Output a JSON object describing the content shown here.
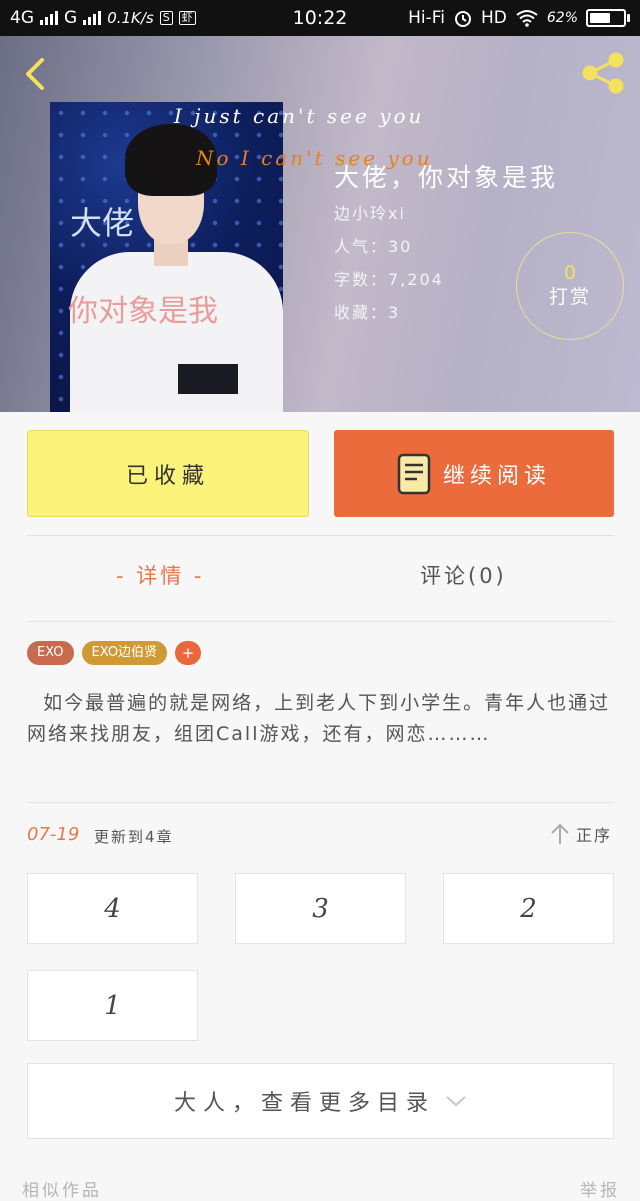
{
  "status_bar": {
    "network_1": "4G",
    "network_2": "G",
    "speed": "0.1K/s",
    "badge_1": "S",
    "badge_2": "虾",
    "time": "10:22",
    "wifi_label": "Hi-Fi",
    "hd_label": "HD",
    "battery": "62%",
    "battery_level": 0.62,
    "icons": [
      "signal-icon",
      "alarm-icon",
      "wifi-icon",
      "battery-icon"
    ]
  },
  "header": {
    "cover_lyric_1": "I just can't see you",
    "cover_lyric_2": "No I can't see you",
    "cover_caption_1": "大佬",
    "cover_caption_2": "你对象是我",
    "title": "大佬，你对象是我",
    "author": "边小玲xi",
    "popularity": "人气：30",
    "word_count": "字数：7,204",
    "favorites": "收藏：3",
    "tip_count": "0",
    "tip_label": "打赏",
    "back_icon": "chevron-left-icon",
    "share_icon": "share-icon",
    "accent_color": "#f4e15c"
  },
  "actions": {
    "collected_label": "已收藏",
    "read_label": "继续阅读",
    "collected_color": "#fbf37a",
    "read_color": "#ec6b3d"
  },
  "tabs": {
    "details": "- 详情 -",
    "comments": "评论(0)"
  },
  "tags": [
    "EXO",
    "EXO边伯贤",
    "+"
  ],
  "intro": "如今最普遍的就是网络，上到老人下到小学生。青年人也通过网络来找朋友，组团Call游戏，还有，网恋………",
  "update": {
    "date": "07-19",
    "text": "更新到4章",
    "order_label": "正序"
  },
  "chapters": [
    "4",
    "3",
    "2",
    "1"
  ],
  "more_label": "大人，查看更多目录",
  "footer": {
    "similar": "相似作品",
    "report": "举报"
  }
}
